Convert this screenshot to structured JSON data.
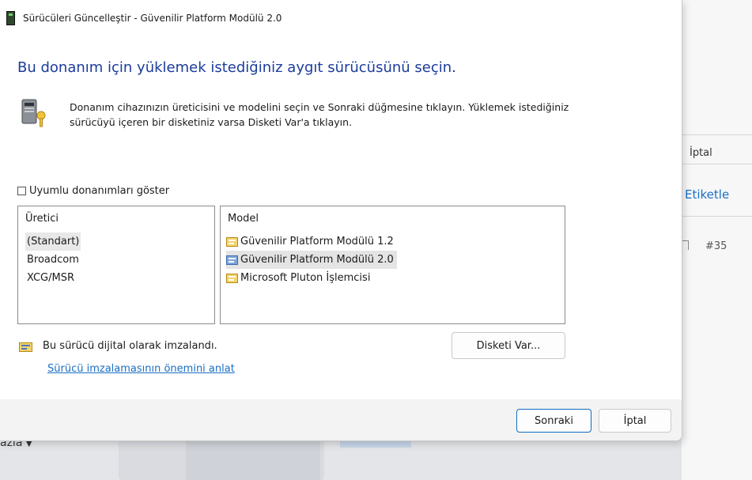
{
  "window": {
    "title": "Sürücüleri Güncelleştir - Güvenilir Platform Modülü 2.0"
  },
  "heading": "Bu donanım için yüklemek istediğiniz aygıt sürücüsünü seçin.",
  "description": "Donanım cihazınızın üreticisini ve modelini seçin ve Sonraki düğmesine tıklayın. Yüklemek istediğiniz sürücüyü içeren bir disketiniz varsa Disketi Var'a tıklayın.",
  "compatible_checkbox": {
    "label": "Uyumlu donanımları göster",
    "checked": false
  },
  "manufacturer_list": {
    "header": "Üretici",
    "items": [
      "(Standart)",
      "Broadcom",
      "XCG/MSR"
    ],
    "selected": "(Standart)"
  },
  "model_list": {
    "header": "Model",
    "items": [
      "Güvenilir Platform Modülü 1.2",
      "Güvenilir Platform Modülü 2.0",
      "Microsoft Pluton İşlemcisi"
    ],
    "selected": "Güvenilir Platform Modülü 2.0"
  },
  "signed_text": "Bu sürücü dijital olarak imzalandı.",
  "signing_link": "Sürücü imzalamasının önemini anlat",
  "have_disk_button": "Disketi Var...",
  "next_button": "Sonraki",
  "cancel_button": "İptal",
  "background": {
    "cancel_label": "İptal",
    "tag_label": "Etiketle",
    "issue_number": "#35",
    "partial_text": "azia"
  },
  "colors": {
    "heading": "#1b3c9c",
    "link": "#1a6fc4",
    "primary_border": "#0f6cbd"
  }
}
